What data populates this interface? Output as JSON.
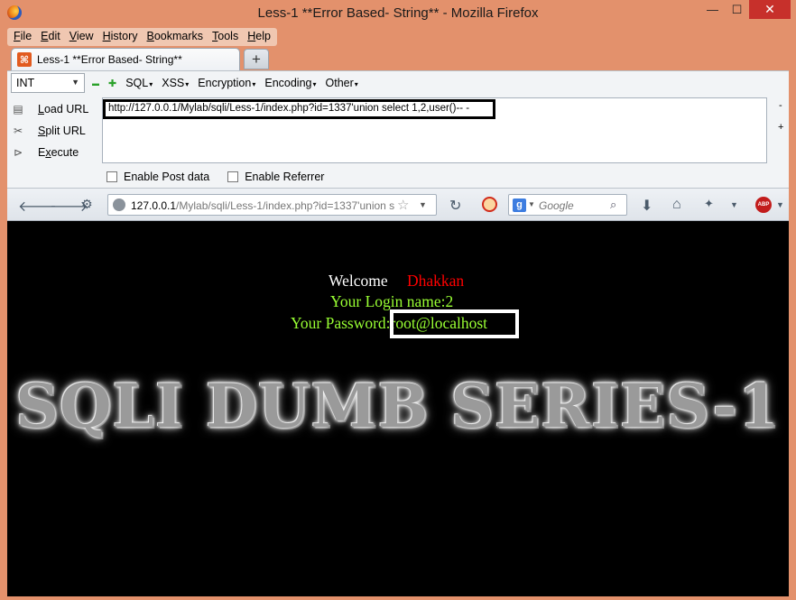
{
  "window": {
    "title": "Less-1 **Error Based- String** - Mozilla Firefox",
    "controls": {
      "minimize": "—",
      "maximize": "☐",
      "close": "✕"
    }
  },
  "menubar": {
    "items": [
      {
        "label": "File",
        "accel": "F",
        "rest": "ile"
      },
      {
        "label": "Edit",
        "accel": "E",
        "rest": "dit"
      },
      {
        "label": "View",
        "accel": "V",
        "rest": "iew"
      },
      {
        "label": "History",
        "accel": "H",
        "rest": "istory"
      },
      {
        "label": "Bookmarks",
        "accel": "B",
        "rest": "ookmarks"
      },
      {
        "label": "Tools",
        "accel": "T",
        "rest": "ools"
      },
      {
        "label": "Help",
        "accel": "H",
        "rest": "elp"
      }
    ]
  },
  "tabs": {
    "active_tab": "Less-1 **Error Based- String**",
    "new_tab_symbol": "+"
  },
  "hackbar": {
    "type_select": "INT",
    "minus_symbol": "▬",
    "plus_symbol": "✚",
    "menus": [
      "SQL",
      "XSS",
      "Encryption",
      "Encoding",
      "Other"
    ],
    "actions": {
      "load": {
        "accel": "L",
        "rest": "oad URL"
      },
      "split": {
        "accel": "S",
        "rest": "plit URL"
      },
      "execute": {
        "accel": "x",
        "pre": "E",
        "rest": "ecute"
      }
    },
    "url": "http://127.0.0.1/Mylab/sqli/Less-1/index.php?id=1337'union select 1,2,user()-- -",
    "side_minus": "-",
    "side_plus": "+",
    "enable_post": "Enable Post data",
    "enable_referrer": "Enable Referrer"
  },
  "navbar": {
    "url_host": "127.0.0.1",
    "url_rest": "/Mylab/sqli/Less-1/index.php?id=1337'union s",
    "search_placeholder": "Google",
    "search_engine_letter": "g",
    "abp_label": "ABP"
  },
  "page": {
    "welcome_label": "Welcome",
    "welcome_name": "Dhakkan",
    "login_line": "Your Login name:2",
    "password_line": "Your Password:root@localhost",
    "banner": "SQLI DUMB SERIES-1"
  },
  "colors": {
    "frame": "#e3916c",
    "page_background": "#000000",
    "welcome_name": "#ff0000",
    "green_text": "#99ff33"
  }
}
